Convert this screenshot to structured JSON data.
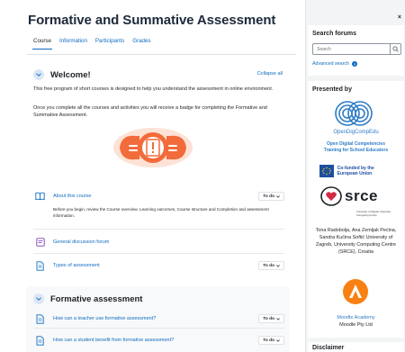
{
  "page": {
    "title": "Formative and Summative Assessment"
  },
  "tabs": [
    "Course",
    "Information",
    "Participants",
    "Grades"
  ],
  "welcome": {
    "title": "Welcome!",
    "collapse_all": "Collapse all",
    "para1": "This free program of short courses is designed to help you understand the assessment in online environment.",
    "para2": "Once you complete all the courses and activities you will receive a badge for completing the Formative and Summative Assessment."
  },
  "activities": [
    {
      "label": "About this course",
      "status": "To do",
      "icon": "book-icon",
      "description": "Before you begin, review the Course overview. Learning outcomes, Course structure and Completion and assessment information."
    },
    {
      "label": "General discussion forum",
      "icon": "forum-icon"
    },
    {
      "label": "Types of assessment",
      "status": "To do",
      "icon": "page-icon"
    }
  ],
  "formative": {
    "title": "Formative assessment",
    "activities": [
      {
        "label": "How can a teacher use formative assessment?",
        "status": "To do",
        "icon": "page-icon"
      },
      {
        "label": "How can a student benefit from formative assessment?",
        "status": "To do",
        "icon": "page-icon"
      }
    ]
  },
  "drawer": {
    "close": "×",
    "search_forums": {
      "title": "Search forums",
      "placeholder": "Search",
      "advanced": "Advanced search"
    },
    "presented_by": {
      "title": "Presented by",
      "odc_name": "OpenDigCompEdu",
      "odc_sub": "Open Digital Competencies Training for School Educators",
      "eu_text": "Co-funded by the European Union",
      "srce_word": "srce",
      "srce_sub": "University of Zagreb University Computing Centre",
      "authors": "Tona Radobolja, Ana Zemljak Pećina, Sandra Kučina Softić University of Zagreb, University Computing Centre (SRCE), Croatia",
      "moodle_name": "Moodle Academy",
      "moodle_sub": "Moodle Pty Ltd"
    },
    "disclaimer": {
      "title": "Disclaimer"
    }
  },
  "colors": {
    "link": "#0f6cbf",
    "hero_orange": "#f26b3a",
    "moodle_orange": "#f98012",
    "eu_blue": "#1e4fa0"
  }
}
